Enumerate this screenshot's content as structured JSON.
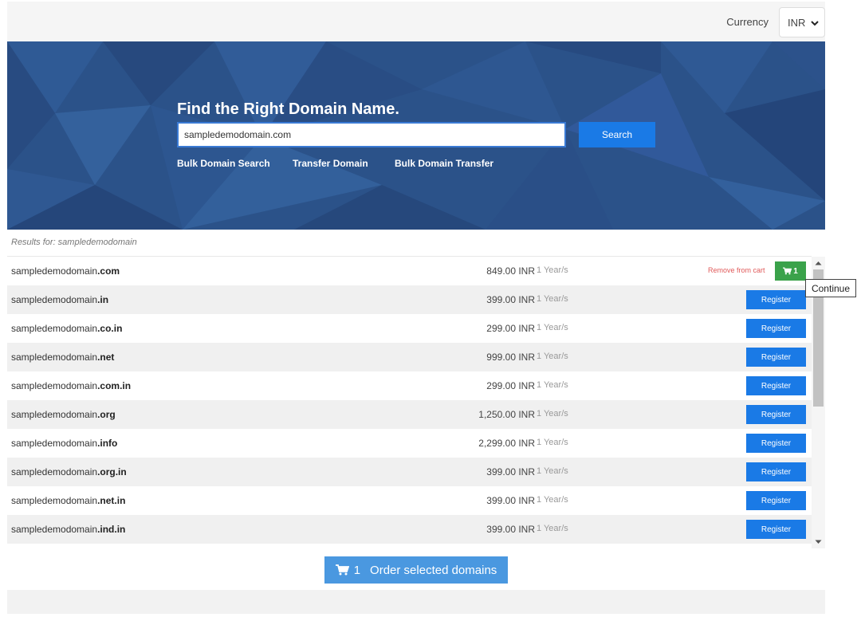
{
  "header": {
    "currency_label": "Currency",
    "currency_value": "INR"
  },
  "hero": {
    "title": "Find the Right Domain Name.",
    "search_value": "sampledemodomain.com",
    "search_button": "Search",
    "links": [
      "Bulk Domain Search",
      "Transfer Domain",
      "Bulk Domain Transfer"
    ]
  },
  "results": {
    "label": "Results for: sampledemodomain",
    "rows": [
      {
        "base": "sampledemodomain",
        "tld": ".com",
        "price": "849.00 INR",
        "term": "1 Year/s",
        "in_cart": true
      },
      {
        "base": "sampledemodomain",
        "tld": ".in",
        "price": "399.00 INR",
        "term": "1 Year/s",
        "in_cart": false
      },
      {
        "base": "sampledemodomain",
        "tld": ".co.in",
        "price": "299.00 INR",
        "term": "1 Year/s",
        "in_cart": false
      },
      {
        "base": "sampledemodomain",
        "tld": ".net",
        "price": "999.00 INR",
        "term": "1 Year/s",
        "in_cart": false
      },
      {
        "base": "sampledemodomain",
        "tld": ".com.in",
        "price": "299.00 INR",
        "term": "1 Year/s",
        "in_cart": false
      },
      {
        "base": "sampledemodomain",
        "tld": ".org",
        "price": "1,250.00 INR",
        "term": "1 Year/s",
        "in_cart": false
      },
      {
        "base": "sampledemodomain",
        "tld": ".info",
        "price": "2,299.00 INR",
        "term": "1 Year/s",
        "in_cart": false
      },
      {
        "base": "sampledemodomain",
        "tld": ".org.in",
        "price": "399.00 INR",
        "term": "1 Year/s",
        "in_cart": false
      },
      {
        "base": "sampledemodomain",
        "tld": ".net.in",
        "price": "399.00 INR",
        "term": "1 Year/s",
        "in_cart": false
      },
      {
        "base": "sampledemodomain",
        "tld": ".ind.in",
        "price": "399.00 INR",
        "term": "1 Year/s",
        "in_cart": false
      }
    ],
    "register_label": "Register",
    "remove_label": "Remove from cart",
    "cart_count": "1",
    "tooltip": "Continue"
  },
  "order": {
    "count": "1",
    "label": "Order selected domains"
  },
  "colors": {
    "hero_bg": "#2a5188",
    "primary": "#1a7ae6",
    "cart_green": "#3aa24a",
    "remove_red": "#e05a5a",
    "order_btn": "#4a98e0"
  },
  "icons": {
    "cart": "shopping-cart-icon",
    "chevron": "chevron-down-icon"
  }
}
